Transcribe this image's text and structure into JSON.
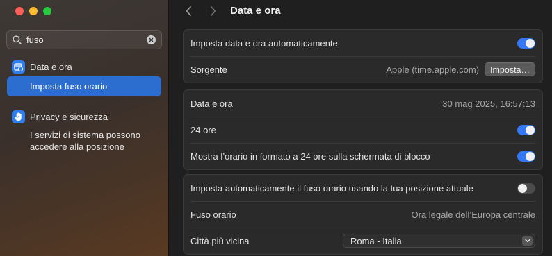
{
  "search": {
    "value": "fuso"
  },
  "sidebar": {
    "groups": [
      {
        "label": "Data e ora",
        "icon": "calendar-clock-icon",
        "items": [
          {
            "label": "Imposta fuso orario"
          }
        ]
      },
      {
        "label": "Privacy e sicurezza",
        "icon": "hand-icon",
        "items": [
          {
            "label": "I servizi di sistema possono accedere alla posizione"
          }
        ]
      }
    ]
  },
  "header": {
    "title": "Data e ora"
  },
  "cards": {
    "auto": {
      "auto_label": "Imposta data e ora automaticamente",
      "auto_on": true,
      "source_label": "Sorgente",
      "source_value": "Apple (time.apple.com)",
      "set_button": "Imposta…"
    },
    "clock": {
      "datetime_label": "Data e ora",
      "datetime_value": "30 mag 2025, 16:57:13",
      "h24_label": "24 ore",
      "h24_on": true,
      "lock_label": "Mostra l’orario in formato a 24 ore sulla schermata di blocco",
      "lock_on": true
    },
    "timezone": {
      "auto_tz_label": "Imposta automaticamente il fuso orario usando la tua posizione attuale",
      "auto_tz_on": false,
      "tz_label": "Fuso orario",
      "tz_value": "Ora legale dell’Europa centrale",
      "city_label": "Città più vicina",
      "city_value": "Roma - Italia"
    }
  },
  "colors": {
    "accent": "#3478f6",
    "selection": "#2b6ed0"
  }
}
